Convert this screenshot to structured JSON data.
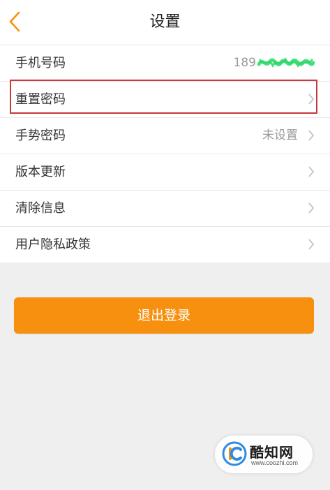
{
  "header": {
    "title": "设置"
  },
  "settings": {
    "phone": {
      "label": "手机号码",
      "value_prefix": "189"
    },
    "reset_password": {
      "label": "重置密码"
    },
    "gesture_password": {
      "label": "手势密码",
      "value": "未设置"
    },
    "version_update": {
      "label": "版本更新"
    },
    "clear_info": {
      "label": "清除信息"
    },
    "privacy_policy": {
      "label": "用户隐私政策"
    }
  },
  "logout": {
    "label": "退出登录"
  },
  "watermark": {
    "name": "酷知网",
    "url": "www.coozhi.com"
  },
  "colors": {
    "accent": "#f7900f",
    "highlight_border": "#c9383a",
    "page_background": "#efefef",
    "mask_green": "#3fe07a"
  },
  "icons": {
    "back": "chevron-left-icon",
    "row_arrow": "chevron-right-icon"
  }
}
